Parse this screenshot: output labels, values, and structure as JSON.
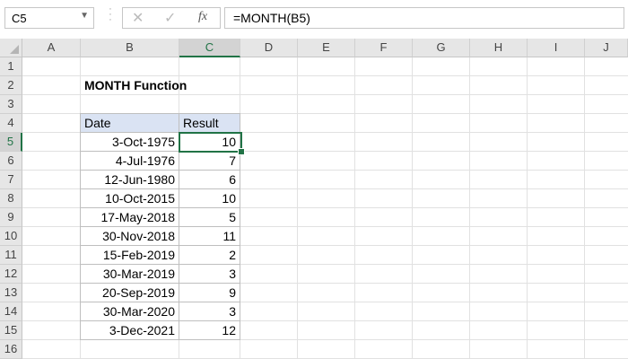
{
  "name_box": {
    "value": "C5"
  },
  "formula_bar": {
    "cancel_icon": "✕",
    "enter_icon": "✓",
    "fx_label": "fx",
    "formula": "=MONTH(B5)"
  },
  "columns": [
    "A",
    "B",
    "C",
    "D",
    "E",
    "F",
    "G",
    "H",
    "I",
    "J"
  ],
  "rows": [
    "1",
    "2",
    "3",
    "4",
    "5",
    "6",
    "7",
    "8",
    "9",
    "10",
    "11",
    "12",
    "13",
    "14",
    "15",
    "16"
  ],
  "sheet": {
    "title": "MONTH Function",
    "header": {
      "date": "Date",
      "result": "Result"
    },
    "records": [
      {
        "date": "3-Oct-1975",
        "result": "10"
      },
      {
        "date": "4-Jul-1976",
        "result": "7"
      },
      {
        "date": "12-Jun-1980",
        "result": "6"
      },
      {
        "date": "10-Oct-2015",
        "result": "10"
      },
      {
        "date": "17-May-2018",
        "result": "5"
      },
      {
        "date": "30-Nov-2018",
        "result": "11"
      },
      {
        "date": "15-Feb-2019",
        "result": "2"
      },
      {
        "date": "30-Mar-2019",
        "result": "3"
      },
      {
        "date": "20-Sep-2019",
        "result": "9"
      },
      {
        "date": "30-Mar-2020",
        "result": "3"
      },
      {
        "date": "3-Dec-2021",
        "result": "12"
      }
    ]
  },
  "colors": {
    "accent": "#217346",
    "header_fill": "#dae3f3"
  }
}
